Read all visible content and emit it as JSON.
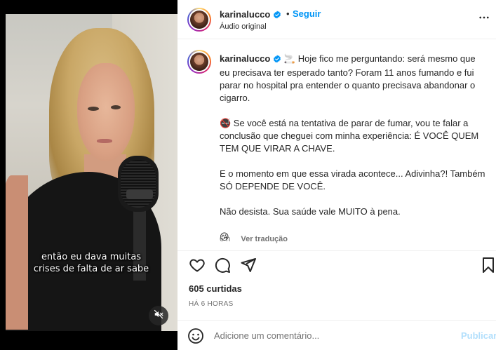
{
  "colors": {
    "accent": "#0095f6",
    "text": "#262626",
    "muted": "#737373",
    "publish_disabled": "#b2dffc",
    "verified": "#0095f6"
  },
  "video": {
    "caption_line1": "então eu dava muitas",
    "caption_line2": "crises de falta de ar sabe",
    "mute_icon": "speaker-muted-icon"
  },
  "header": {
    "username": "karinalucco",
    "dot": "•",
    "follow_label": "Seguir",
    "audio_label": "Áudio original",
    "more_icon": "more-horizontal-icon"
  },
  "post": {
    "username": "karinalucco",
    "paragraphs": [
      "🚬 Hoje fico me perguntando: será mesmo que eu precisava ter esperado tanto? Foram 11 anos fumando e fui parar no hospital pra entender o quanto precisava abandonar o cigarro.",
      "🚭 Se você está na tentativa de parar de fumar, vou te falar a conclusão que cheguei com minha experiência: É VOCÊ QUEM TEM QUE VIRAR A CHAVE.",
      "E o momento em que essa virada acontece... Adivinha?! Também SÓ DEPENDE DE VOCÊ.",
      "Não desista. Sua saúde vale MUITO à pena.",
      "😘"
    ],
    "time_ago": "6 h",
    "translate_label": "Ver tradução"
  },
  "actions": {
    "like_icon": "heart-icon",
    "comment_icon": "comment-bubble-icon",
    "share_icon": "paper-plane-icon",
    "save_icon": "bookmark-icon",
    "likes_text": "605 curtidas",
    "timestamp": "HÁ 6 HORAS"
  },
  "comment_box": {
    "placeholder": "Adicione um comentário...",
    "publish_label": "Publicar",
    "emoji_icon": "smiley-icon"
  }
}
